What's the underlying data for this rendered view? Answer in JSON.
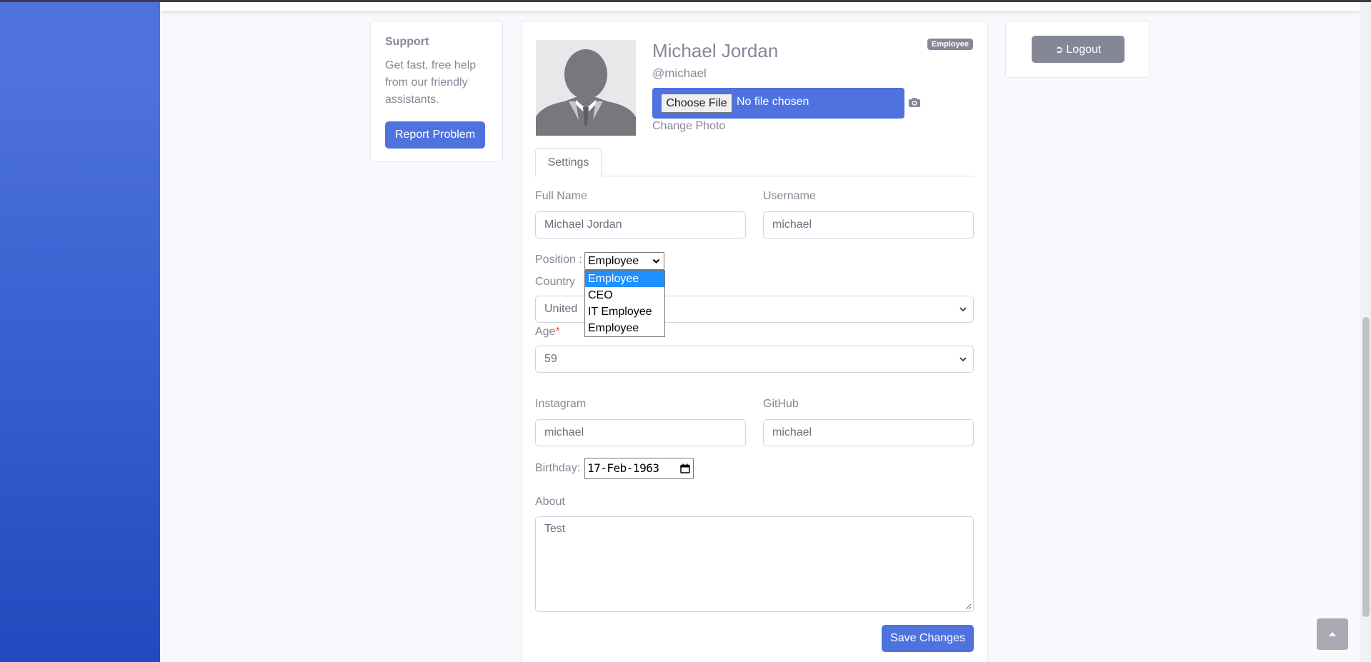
{
  "support": {
    "title": "Support",
    "text": "Get fast, free help from our friendly assistants.",
    "button": "Report Problem"
  },
  "logout": {
    "label": "Logout",
    "icon": "sign-out-icon"
  },
  "profile": {
    "name": "Michael Jordan",
    "handle": "@michael",
    "badge": "Employee",
    "choose_file": "Choose File",
    "no_file": "No file chosen",
    "change_photo": "Change Photo"
  },
  "tabs": {
    "settings": "Settings"
  },
  "form": {
    "full_name": {
      "label": "Full Name",
      "value": "Michael Jordan"
    },
    "username": {
      "label": "Username",
      "value": "michael"
    },
    "position": {
      "label": "Position :",
      "selected": "Employee",
      "options": [
        "Employee",
        "CEO",
        "IT Employee",
        "Employee"
      ]
    },
    "country": {
      "label": "Country",
      "value": "United"
    },
    "age": {
      "label": "Age",
      "required": "*",
      "value": "59"
    },
    "instagram": {
      "label": "Instagram",
      "value": "michael"
    },
    "github": {
      "label": "GitHub",
      "value": "michael"
    },
    "birthday": {
      "label": "Birthday:",
      "value": "17-Feb-1963"
    },
    "about": {
      "label": "About",
      "value": "Test"
    },
    "save": "Save Changes"
  },
  "colors": {
    "primary": "#4e73df",
    "secondary": "#858796",
    "sidebar_top": "#4e73df",
    "sidebar_bottom": "#224abe",
    "selected_option": "#1e90ff"
  }
}
